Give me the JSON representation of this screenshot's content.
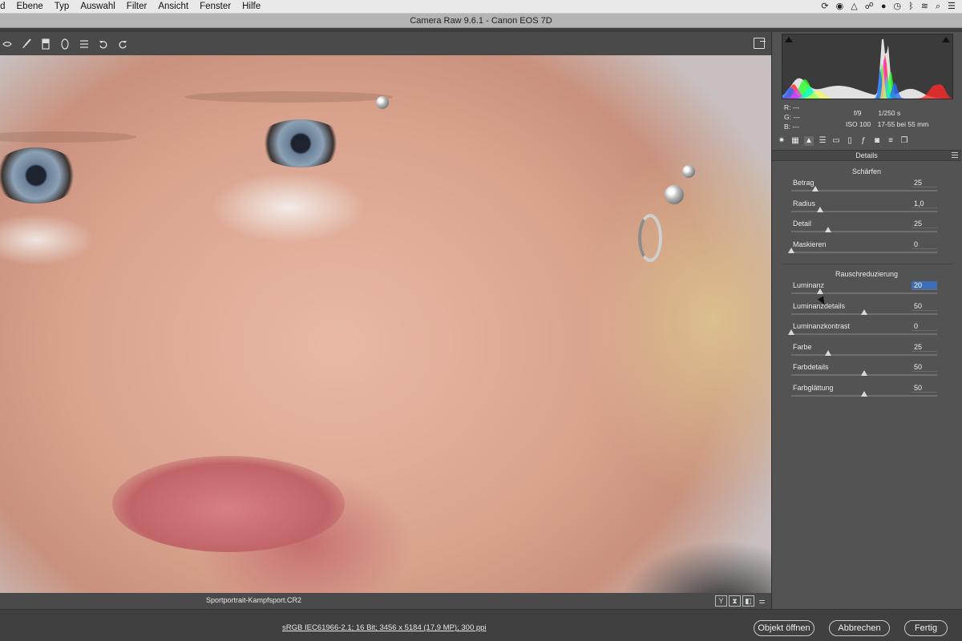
{
  "menubar": {
    "items": [
      "ild",
      "Ebene",
      "Typ",
      "Auswahl",
      "Filter",
      "Ansicht",
      "Fenster",
      "Hilfe"
    ]
  },
  "window": {
    "title": "Camera Raw 9.6.1  -  Canon EOS 7D"
  },
  "toolbar": {
    "tools": [
      "eye-tool-icon",
      "brush-icon",
      "graduated-filter-icon",
      "radial-filter-icon",
      "preferences-list-icon",
      "rotate-left-icon",
      "rotate-right-icon"
    ],
    "fullscreen_icon": "fullscreen-toggle-icon"
  },
  "image": {
    "filename": "Sportportrait-Kampfsport.CR2"
  },
  "view_buttons": [
    "Y",
    "⧗",
    "◧",
    "⚌"
  ],
  "histogram": {
    "colors": [
      "#ff2a2a",
      "#2aff2a",
      "#2a6bff",
      "#ff33ff",
      "#00ffff",
      "#ffff33",
      "#ffffff"
    ]
  },
  "exif": {
    "r_label": "R:",
    "r_value": "---",
    "g_label": "G:",
    "g_value": "---",
    "b_label": "B:",
    "b_value": "---",
    "aperture": "f/9",
    "shutter": "1/250 s",
    "iso": "ISO 100",
    "lens": "17-55 bei 55 mm"
  },
  "panel_tabs": [
    "basic-icon",
    "tone-curve-icon",
    "detail-icon",
    "hsl-icon",
    "split-toning-icon",
    "lens-icon",
    "effects-icon",
    "camera-calibration-icon",
    "presets-icon",
    "snapshots-icon"
  ],
  "panel": {
    "title": "Details",
    "sharpening": {
      "heading": "Schärfen",
      "sliders": [
        {
          "label": "Betrag",
          "value": "25",
          "fraction": 0.167
        },
        {
          "label": "Radius",
          "value": "1,0",
          "fraction": 0.2
        },
        {
          "label": "Detail",
          "value": "25",
          "fraction": 0.25
        },
        {
          "label": "Maskieren",
          "value": "0",
          "fraction": 0
        }
      ]
    },
    "noise": {
      "heading": "Rauschreduzierung",
      "sliders": [
        {
          "label": "Luminanz",
          "value": "20",
          "fraction": 0.2,
          "focused": true
        },
        {
          "label": "Luminanzdetails",
          "value": "50",
          "fraction": 0.5
        },
        {
          "label": "Luminanzkontrast",
          "value": "0",
          "fraction": 0
        },
        {
          "label": "Farbe",
          "value": "25",
          "fraction": 0.25
        },
        {
          "label": "Farbdetails",
          "value": "50",
          "fraction": 0.5
        },
        {
          "label": "Farbglättung",
          "value": "50",
          "fraction": 0.5
        }
      ]
    }
  },
  "bottom": {
    "workflow": "sRGB IEC61966-2.1; 16 Bit; 3456 x 5184 (17,9 MP); 300 ppi",
    "open_button": "Objekt öffnen",
    "cancel_button": "Abbrechen",
    "done_button": "Fertig"
  }
}
